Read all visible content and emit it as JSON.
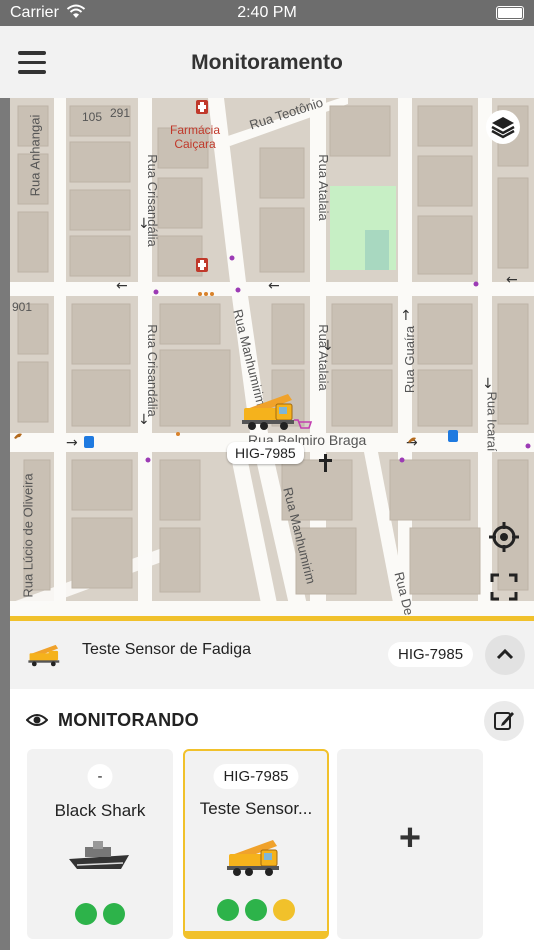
{
  "status_bar": {
    "carrier": "Carrier",
    "time": "2:40 PM"
  },
  "nav": {
    "title": "Monitoramento"
  },
  "map": {
    "streets": [
      "Rua Anhangai",
      "Rua Crisandália",
      "Rua Crisandália",
      "Rua Teotônio",
      "Rua Atalaia",
      "Rua Atalaia",
      "Rua Manhumirim",
      "Rua Manhumirim",
      "Rua Guaíra",
      "Rua Icaraí",
      "Rua Belmiro Braga",
      "Rua Lúcio de Oliveira",
      "Rua De"
    ],
    "house_numbers": [
      "105",
      "291",
      "901"
    ],
    "pharmacy": {
      "line1": "Farmácia",
      "line2": "Caiçara"
    },
    "vehicle_label": "HIG-7985"
  },
  "selected": {
    "name": "Teste Sensor de Fadiga",
    "plate": "HIG-7985"
  },
  "monitoring": {
    "label": "MONITORANDO",
    "cards": [
      {
        "pill": "-",
        "name": "Black Shark"
      },
      {
        "pill": "HIG-7985",
        "name": "Teste Sensor..."
      },
      {
        "add": "+"
      }
    ]
  },
  "colors": {
    "accent": "#f1c12b",
    "status_green": "#2db34a",
    "warning": "#f1c12b"
  },
  "icons": [
    "hamburger-menu-icon",
    "wifi-icon",
    "battery-icon",
    "layers-icon",
    "locate-icon",
    "fullscreen-icon",
    "chevron-up-icon",
    "eye-icon",
    "edit-icon",
    "key-icon",
    "signal-icon",
    "warning-icon",
    "plus-icon"
  ]
}
